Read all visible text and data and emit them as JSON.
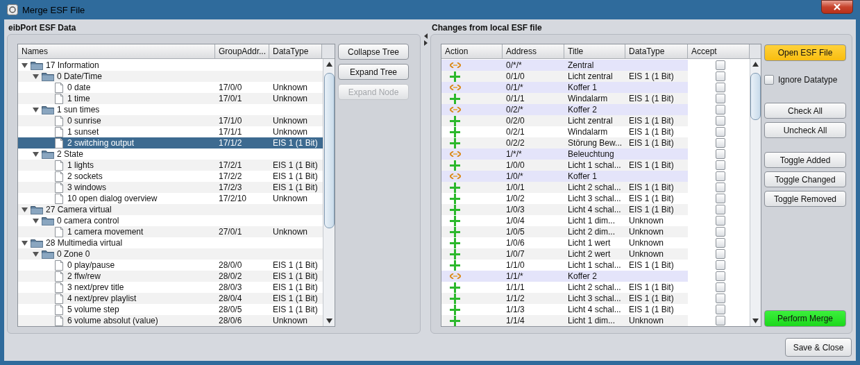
{
  "window": {
    "title": "Merge ESF File"
  },
  "left_panel": {
    "title": "eibPort ESF Data",
    "columns": [
      "Names",
      "GroupAddr...",
      "DataType"
    ],
    "tree": [
      {
        "kind": "folder",
        "name": "17 Information",
        "expanded": true,
        "selected": false,
        "children": [
          {
            "kind": "folder",
            "name": "0 Date/Time",
            "expanded": true,
            "selected": false,
            "children": [
              {
                "kind": "file",
                "name": "0 date",
                "address": "17/0/0",
                "datatype": "Unknown",
                "selected": false
              },
              {
                "kind": "file",
                "name": "1 time",
                "address": "17/0/1",
                "datatype": "Unknown",
                "selected": false
              }
            ]
          },
          {
            "kind": "folder",
            "name": "1 sun times",
            "expanded": true,
            "selected": false,
            "children": [
              {
                "kind": "file",
                "name": "0 sunrise",
                "address": "17/1/0",
                "datatype": "Unknown",
                "selected": false
              },
              {
                "kind": "file",
                "name": "1 sunset",
                "address": "17/1/1",
                "datatype": "Unknown",
                "selected": false
              },
              {
                "kind": "file",
                "name": "2 switching output",
                "address": "17/1/2",
                "datatype": "EIS 1 (1 Bit)",
                "selected": true
              }
            ]
          },
          {
            "kind": "folder",
            "name": "2 State",
            "expanded": true,
            "selected": false,
            "children": [
              {
                "kind": "file",
                "name": "1 lights",
                "address": "17/2/1",
                "datatype": "EIS 1 (1 Bit)",
                "selected": false
              },
              {
                "kind": "file",
                "name": "2 sockets",
                "address": "17/2/2",
                "datatype": "EIS 1 (1 Bit)",
                "selected": false
              },
              {
                "kind": "file",
                "name": "3 windows",
                "address": "17/2/3",
                "datatype": "EIS 1 (1 Bit)",
                "selected": false
              },
              {
                "kind": "file",
                "name": "10 open dialog overview",
                "address": "17/2/10",
                "datatype": "Unknown",
                "selected": false
              }
            ]
          }
        ]
      },
      {
        "kind": "folder",
        "name": "27 Camera virtual",
        "expanded": true,
        "selected": false,
        "children": [
          {
            "kind": "folder",
            "name": "0 camera control",
            "expanded": true,
            "selected": false,
            "children": [
              {
                "kind": "file",
                "name": "1 camera movement",
                "address": "27/0/1",
                "datatype": "Unknown",
                "selected": false
              }
            ]
          }
        ]
      },
      {
        "kind": "folder",
        "name": "28 Multimedia virtual",
        "expanded": true,
        "selected": false,
        "children": [
          {
            "kind": "folder",
            "name": "0 Zone 0",
            "expanded": true,
            "selected": false,
            "children": [
              {
                "kind": "file",
                "name": "0 play/pause",
                "address": "28/0/0",
                "datatype": "EIS 1 (1 Bit)",
                "selected": false
              },
              {
                "kind": "file",
                "name": "2 ffw/rew",
                "address": "28/0/2",
                "datatype": "EIS 1 (1 Bit)",
                "selected": false
              },
              {
                "kind": "file",
                "name": "3 next/prev title",
                "address": "28/0/3",
                "datatype": "EIS 1 (1 Bit)",
                "selected": false
              },
              {
                "kind": "file",
                "name": "4 next/prev playlist",
                "address": "28/0/4",
                "datatype": "EIS 1 (1 Bit)",
                "selected": false
              },
              {
                "kind": "file",
                "name": "5 volume step",
                "address": "28/0/5",
                "datatype": "EIS 1 (1 Bit)",
                "selected": false
              },
              {
                "kind": "file",
                "name": "6 volume absolut (value)",
                "address": "28/0/6",
                "datatype": "Unknown",
                "selected": false
              }
            ]
          }
        ]
      }
    ],
    "buttons": [
      {
        "label": "Collapse Tree",
        "disabled": false
      },
      {
        "label": "Expand Tree",
        "disabled": false
      },
      {
        "label": "Expand Node",
        "disabled": true
      }
    ]
  },
  "right_panel": {
    "title": "Changes from local ESF file",
    "columns": [
      "Action",
      "Address",
      "Title",
      "DataType",
      "Accept"
    ],
    "rows": [
      {
        "kind": "changed",
        "address": "0/*/*",
        "title": "Zentral",
        "datatype": "",
        "accept": false
      },
      {
        "kind": "added",
        "address": "0/1/0",
        "title": "Licht zentral",
        "datatype": "EIS 1 (1 Bit)",
        "accept": false
      },
      {
        "kind": "changed",
        "address": "0/1/*",
        "title": "Koffer 1",
        "datatype": "",
        "accept": false
      },
      {
        "kind": "added",
        "address": "0/1/1",
        "title": "Windalarm",
        "datatype": "EIS 1 (1 Bit)",
        "accept": false
      },
      {
        "kind": "changed",
        "address": "0/2/*",
        "title": "Koffer 2",
        "datatype": "",
        "accept": false
      },
      {
        "kind": "added",
        "address": "0/2/0",
        "title": "Licht zentral",
        "datatype": "EIS 1 (1 Bit)",
        "accept": false
      },
      {
        "kind": "added",
        "address": "0/2/1",
        "title": "Windalarm",
        "datatype": "EIS 1 (1 Bit)",
        "accept": false
      },
      {
        "kind": "added",
        "address": "0/2/2",
        "title": "Störung Bew...",
        "datatype": "EIS 1 (1 Bit)",
        "accept": false
      },
      {
        "kind": "changed",
        "address": "1/*/*",
        "title": "Beleuchtung",
        "datatype": "",
        "accept": false
      },
      {
        "kind": "added",
        "address": "1/0/0",
        "title": "Licht 1 schal...",
        "datatype": "EIS 1 (1 Bit)",
        "accept": false
      },
      {
        "kind": "changed",
        "address": "1/0/*",
        "title": "Koffer 1",
        "datatype": "",
        "accept": false
      },
      {
        "kind": "added",
        "address": "1/0/1",
        "title": "Licht 2 schal...",
        "datatype": "EIS 1 (1 Bit)",
        "accept": false
      },
      {
        "kind": "added",
        "address": "1/0/2",
        "title": "Licht 3 schal...",
        "datatype": "EIS 1 (1 Bit)",
        "accept": false
      },
      {
        "kind": "added",
        "address": "1/0/3",
        "title": "Licht 4 schal...",
        "datatype": "EIS 1 (1 Bit)",
        "accept": false
      },
      {
        "kind": "added",
        "address": "1/0/4",
        "title": "Licht 1 dim...",
        "datatype": "Unknown",
        "accept": false
      },
      {
        "kind": "added",
        "address": "1/0/5",
        "title": "Licht 2 dim...",
        "datatype": "Unknown",
        "accept": false
      },
      {
        "kind": "added",
        "address": "1/0/6",
        "title": "Licht 1 wert",
        "datatype": "Unknown",
        "accept": false
      },
      {
        "kind": "added",
        "address": "1/0/7",
        "title": "Licht 2 wert",
        "datatype": "Unknown",
        "accept": false
      },
      {
        "kind": "added",
        "address": "1/1/0",
        "title": "Licht 1 schal...",
        "datatype": "EIS 1 (1 Bit)",
        "accept": false
      },
      {
        "kind": "changed",
        "address": "1/1/*",
        "title": "Koffer 2",
        "datatype": "",
        "accept": false
      },
      {
        "kind": "added",
        "address": "1/1/1",
        "title": "Licht 2 schal...",
        "datatype": "EIS 1 (1 Bit)",
        "accept": false
      },
      {
        "kind": "added",
        "address": "1/1/2",
        "title": "Licht 3 schal...",
        "datatype": "EIS 1 (1 Bit)",
        "accept": false
      },
      {
        "kind": "added",
        "address": "1/1/3",
        "title": "Licht 4 schal...",
        "datatype": "EIS 1 (1 Bit)",
        "accept": false
      },
      {
        "kind": "added",
        "address": "1/1/4",
        "title": "Licht 1 dim...",
        "datatype": "Unknown",
        "accept": false
      }
    ],
    "open_button": "Open ESF File",
    "ignore_datatype": {
      "label": "Ignore Datatype",
      "checked": false
    },
    "button_groups": [
      [
        "Check All",
        "Uncheck All"
      ],
      [
        "Toggle Added",
        "Toggle Changed",
        "Toggle Removed"
      ]
    ],
    "merge_button": "Perform Merge"
  },
  "footer_button": "Save & Close"
}
